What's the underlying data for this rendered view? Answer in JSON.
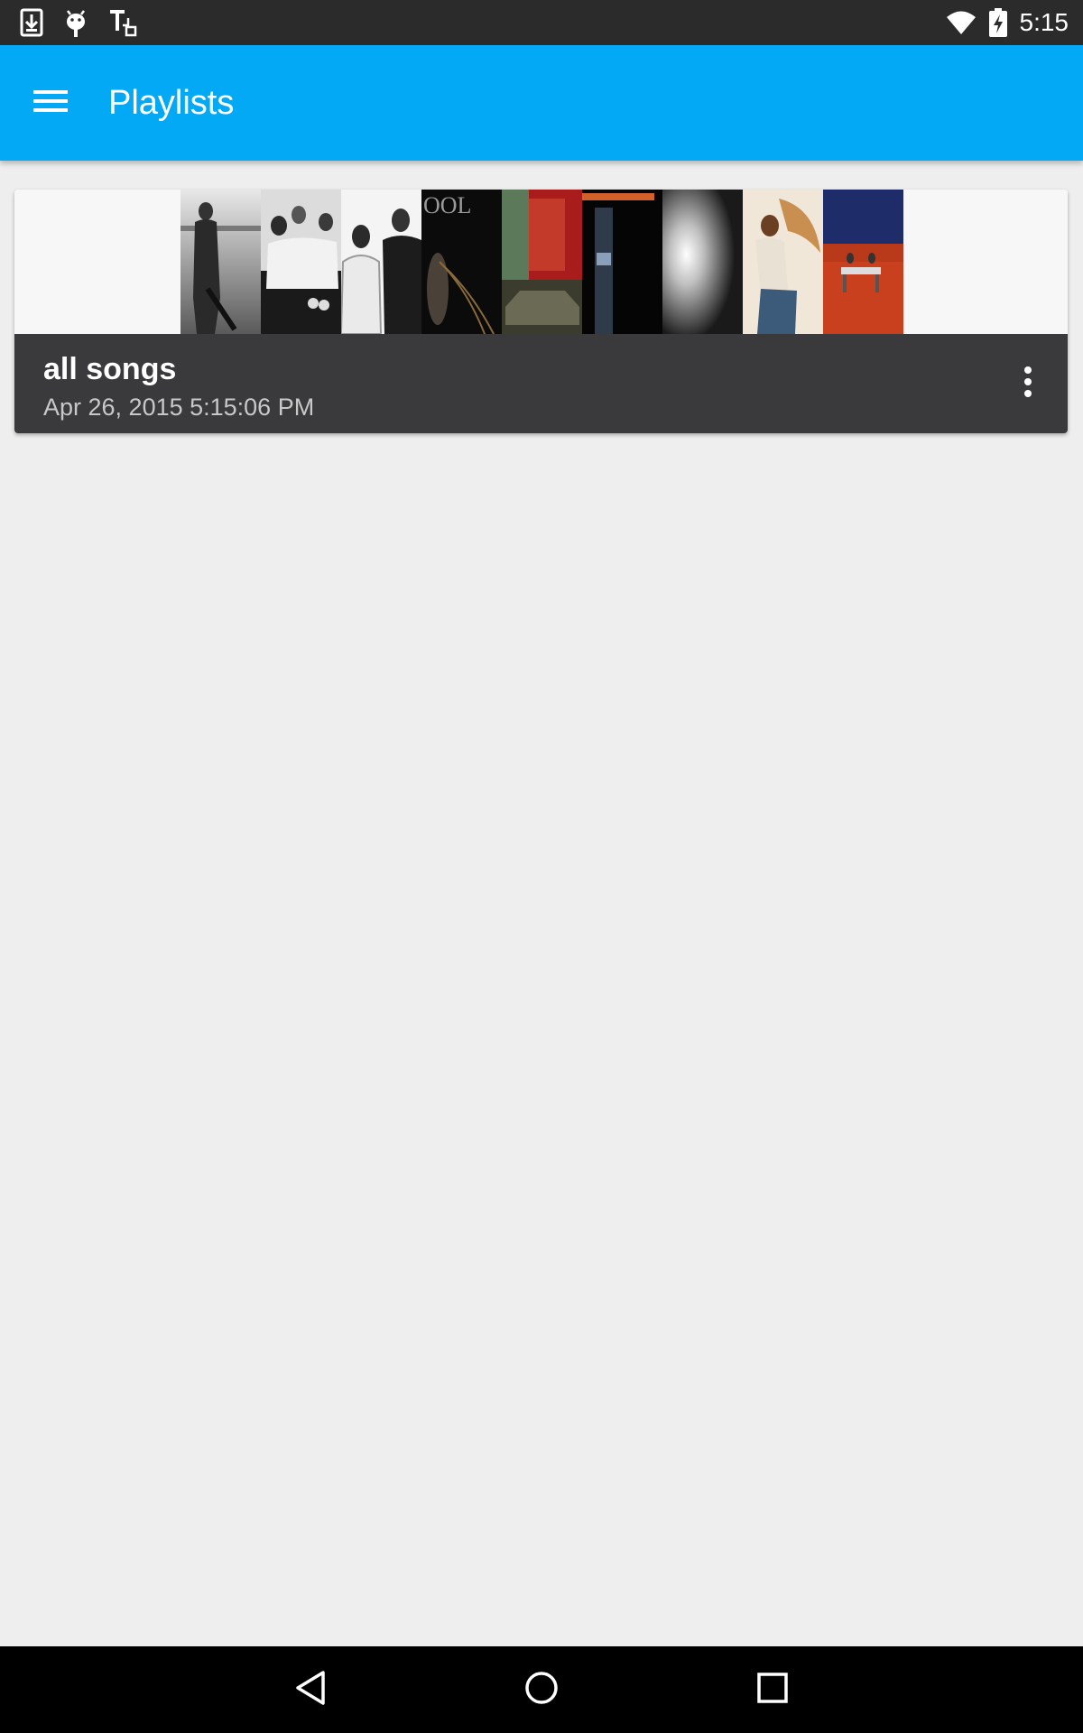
{
  "status_bar": {
    "time": "5:15",
    "left_icons": [
      "download-icon",
      "android-debug-icon",
      "text-input-icon"
    ],
    "right_icons": [
      "wifi-icon",
      "battery-charging-icon"
    ]
  },
  "app_bar": {
    "title": "Playlists",
    "menu_icon": "hamburger-menu-icon",
    "color": "#03a9f4"
  },
  "playlists": [
    {
      "name": "all songs",
      "date": "Apr 26, 2015 5:15:06 PM",
      "overflow_icon": "more-vert-icon",
      "cover_count": 9
    }
  ],
  "nav_bar": {
    "buttons": [
      "back-icon",
      "home-icon",
      "recents-icon"
    ]
  }
}
